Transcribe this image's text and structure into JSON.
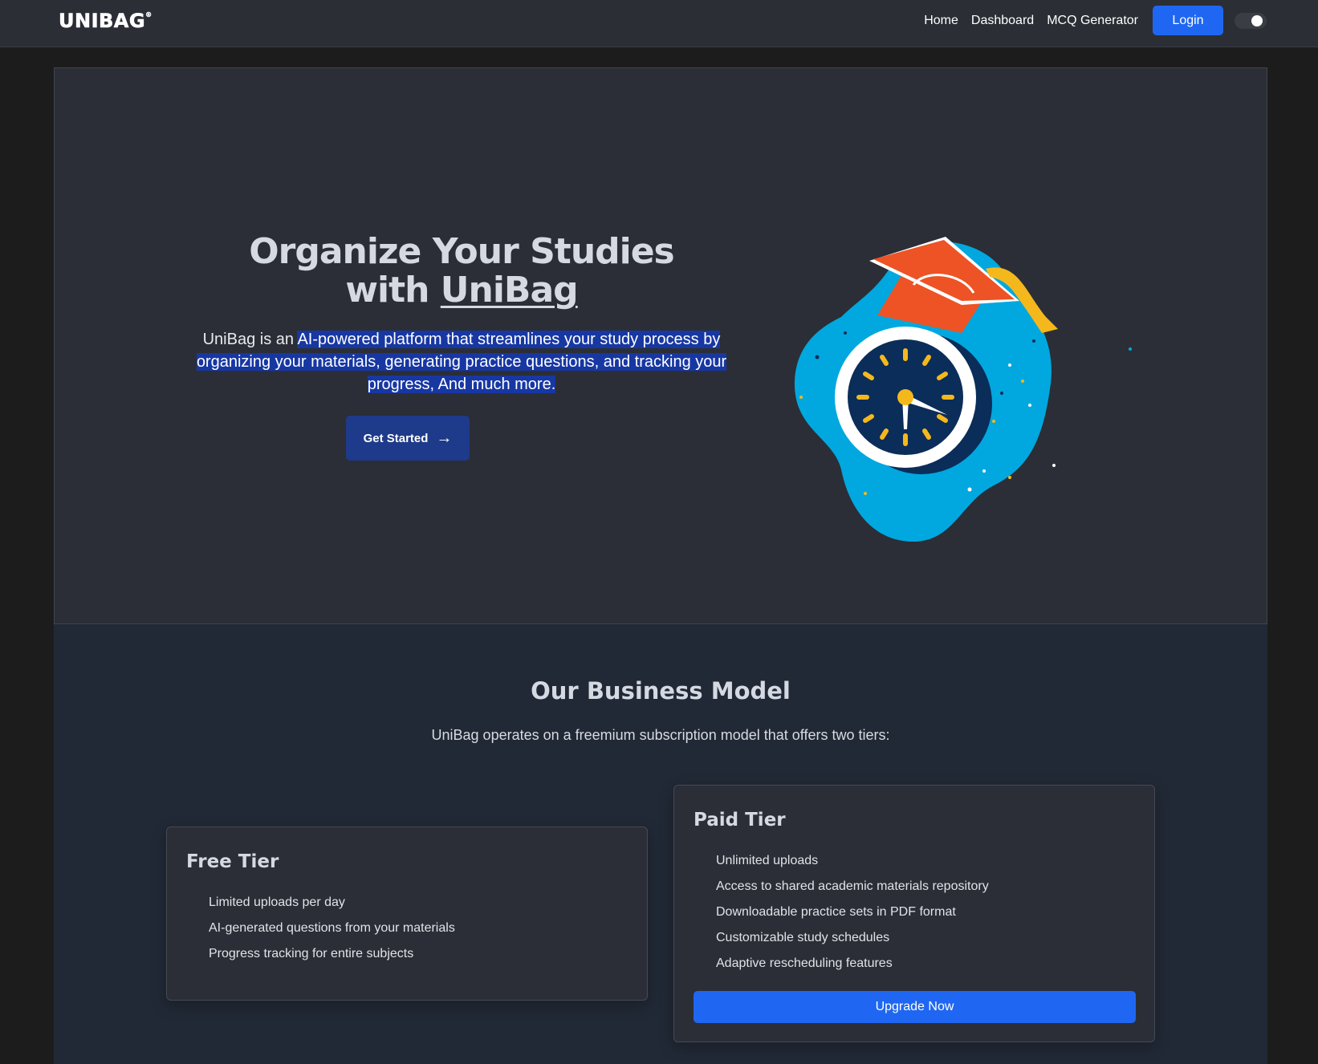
{
  "navbar": {
    "logo": "UNIBAG",
    "logo_mark": "®",
    "links": [
      "Home",
      "Dashboard",
      "MCQ Generator"
    ],
    "login_label": "Login"
  },
  "hero": {
    "title_line1": "Organize Your Studies",
    "title_prefix": "with ",
    "title_brand": "UniBag",
    "desc_plain": "UniBag is an ",
    "desc_highlighted": "AI-powered platform that streamlines your study process by organizing your materials, generating practice questions, and tracking your progress, And much more.",
    "cta_label": "Get Started",
    "cta_icon": "arrow-right-icon",
    "illustration": "graduation-cap-clock-illustration"
  },
  "business": {
    "title": "Our Business Model",
    "subtitle": "UniBag operates on a freemium subscription model that offers two tiers:",
    "tiers": [
      {
        "name": "Free Tier",
        "features": [
          "Limited uploads per day",
          "AI-generated questions from your materials",
          "Progress tracking for entire subjects"
        ]
      },
      {
        "name": "Paid Tier",
        "features": [
          "Unlimited uploads",
          "Access to shared academic materials repository",
          "Downloadable practice sets in PDF format",
          "Customizable study schedules",
          "Adaptive rescheduling features"
        ],
        "button_label": "Upgrade Now"
      }
    ]
  },
  "colors": {
    "accent": "#1f67f2",
    "cta": "#1e3a8a",
    "highlight": "#1737a3",
    "hero_bg": "#2b2e36",
    "section_bg": "#212936"
  }
}
